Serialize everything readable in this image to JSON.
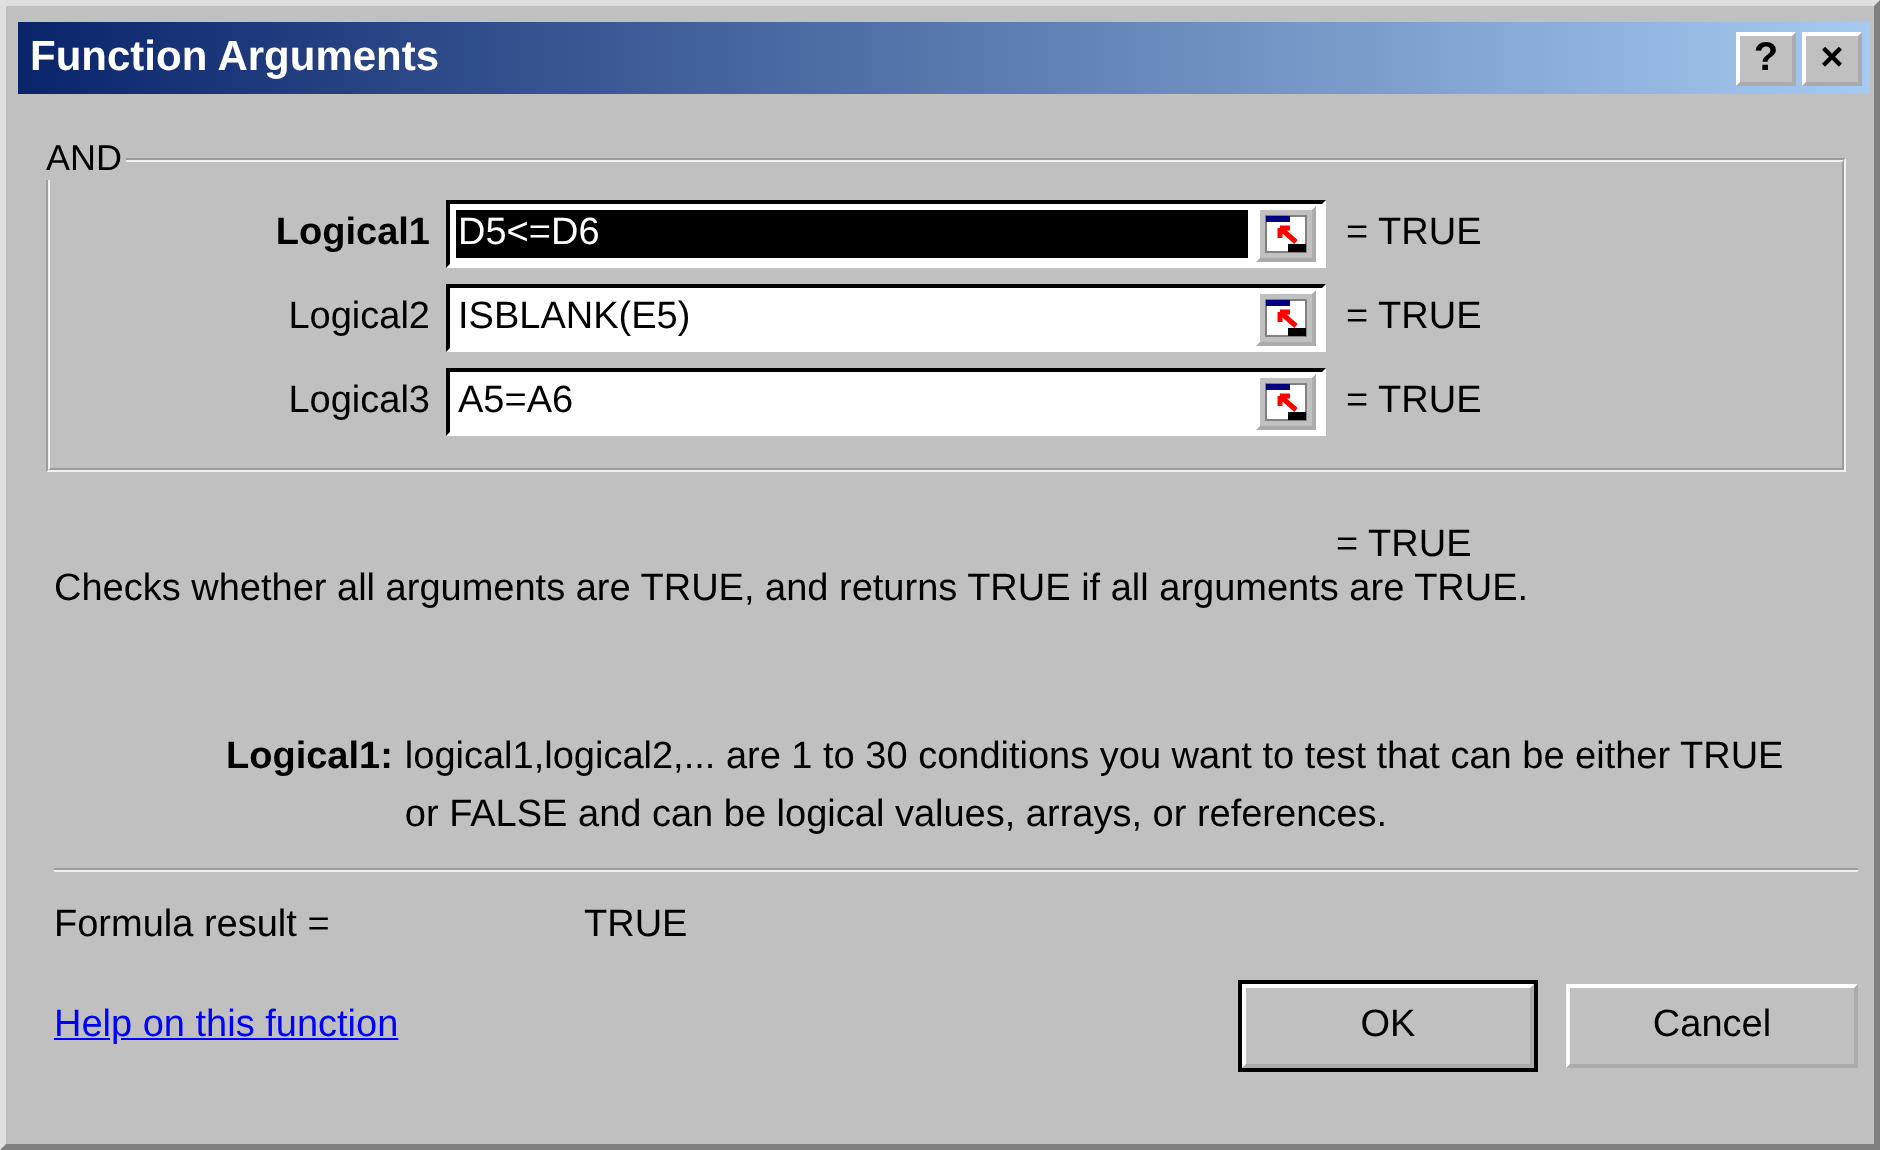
{
  "window": {
    "title": "Function Arguments",
    "buttons": [
      "?",
      "×"
    ]
  },
  "function_group": {
    "name": "AND",
    "arguments": [
      {
        "label": "Logical1",
        "value": "D5<=D6",
        "result": "= TRUE",
        "selected": true
      },
      {
        "label": "Logical2",
        "value": "ISBLANK(E5)",
        "result": "= TRUE",
        "selected": false
      },
      {
        "label": "Logical3",
        "value": "A5=A6",
        "result": "= TRUE",
        "selected": false
      }
    ]
  },
  "overall_result": "= TRUE",
  "description": "Checks whether all arguments are TRUE, and returns TRUE if all arguments are TRUE.",
  "argument_help": {
    "label": "Logical1:",
    "text": "logical1,logical2,... are 1 to 30 conditions you want to test that can be either TRUE or FALSE and can be logical values, arrays, or references."
  },
  "formula_result": {
    "label": "Formula result =",
    "value": "TRUE"
  },
  "help_link": "Help on this function",
  "buttons": [
    {
      "label": "OK",
      "default": true
    },
    {
      "label": "Cancel",
      "default": false
    }
  ]
}
